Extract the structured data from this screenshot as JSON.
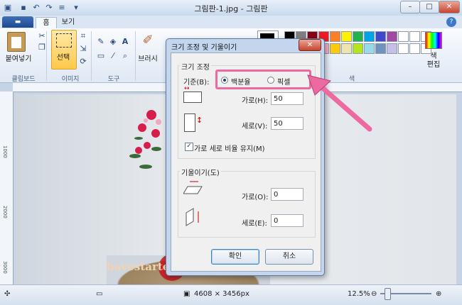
{
  "window": {
    "title": "그림판-1.jpg - 그림판"
  },
  "tabs": {
    "menu": "▬",
    "home": "홈",
    "view": "보기"
  },
  "ribbon": {
    "paste_label": "붙여넣기",
    "select_label": "선택",
    "brush_label": "브러시",
    "groups": {
      "clipboard": "클립보드",
      "image": "이미지",
      "tools": "도구",
      "colors": "색"
    },
    "edit_colors_label": "색\n편집",
    "palette_row1": [
      "#ed1c24",
      "#ff7f27",
      "#fff200",
      "#22b14c",
      "#00a2e8",
      "#3f48cc",
      "#a349a4",
      "#ffffff",
      "#ffffff",
      "#ffffff"
    ],
    "palette_row2": [
      "#ffaec9",
      "#ffc90e",
      "#efe4b0",
      "#b5e61d",
      "#99d9ea",
      "#7092be",
      "#c8bfe7",
      "#ffffff",
      "#ffffff",
      "#ffffff"
    ],
    "palette_left_row1": [
      "#000000",
      "#7f7f7f",
      "#880015"
    ],
    "palette_left_row2": [
      "#ffffff",
      "#c3c3c3",
      "#b97a57"
    ]
  },
  "ruler": {
    "left_mark": "1000",
    "left_mark2": "2000",
    "left_mark3": "3000"
  },
  "dialog": {
    "title": "크기 조정 및 기울이기",
    "resize_section": "크기 조정",
    "basis_label": "기준(B):",
    "percent_label": "백분율",
    "pixel_label": "픽셀",
    "horizontal_label": "가로(H):",
    "horizontal_value": "50",
    "vertical_label": "세로(V):",
    "vertical_value": "50",
    "keep_ratio_label": "가로 세로 비율 유지(M)",
    "skew_section": "기울이기(도)",
    "skew_h_label": "가로(O):",
    "skew_h_value": "0",
    "skew_v_label": "세로(E):",
    "skew_v_value": "0",
    "ok_label": "확인",
    "cancel_label": "취소"
  },
  "statusbar": {
    "dimensions": "4608 × 3456px",
    "zoom": "12.5%"
  },
  "watermark": "havestartedtheend history",
  "colors": {
    "highlight": "#ec6aa0",
    "arrow": "#ec6aa0",
    "accent": "#3d79c8"
  }
}
